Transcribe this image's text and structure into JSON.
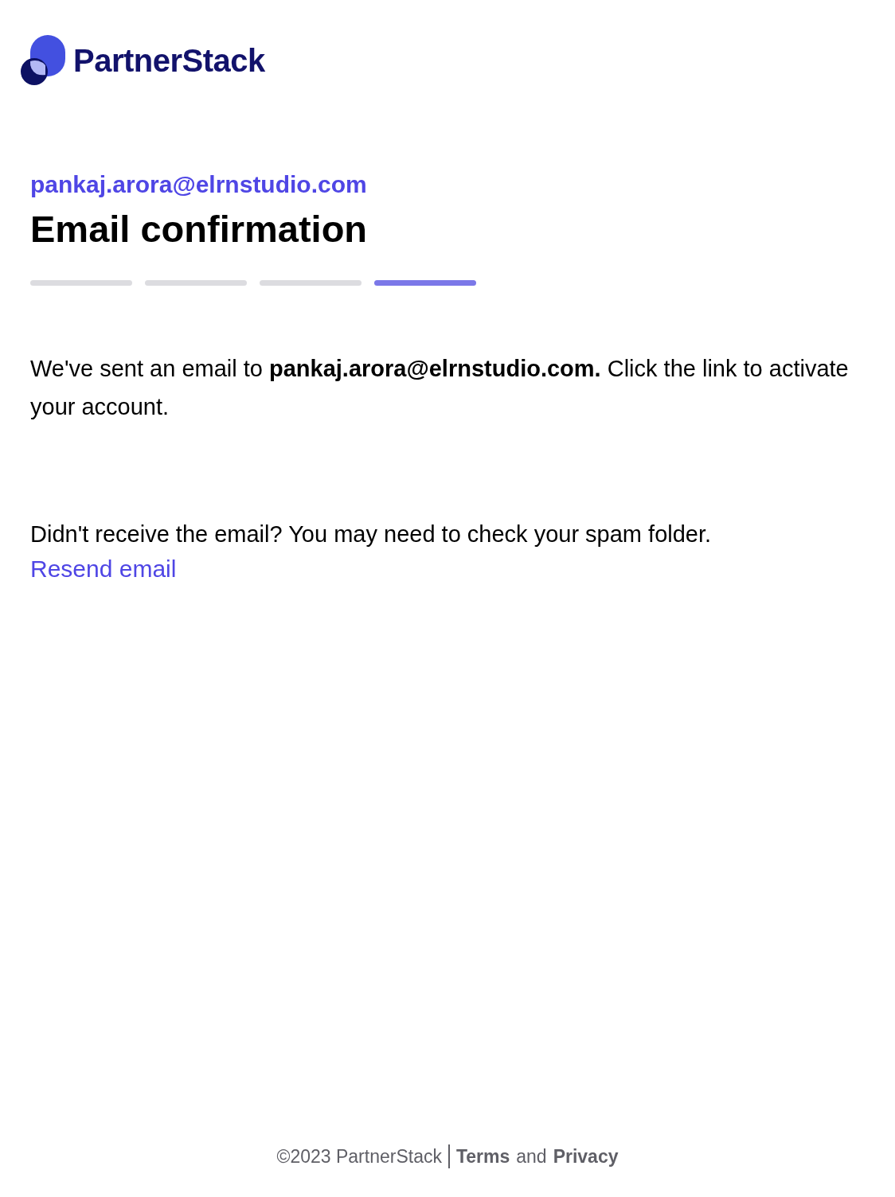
{
  "logo": {
    "wordmark": "PartnerStack"
  },
  "account_email": "pankaj.arora@elrnstudio.com",
  "title": "Email confirmation",
  "progress_steps": [
    {
      "selected": false
    },
    {
      "selected": false
    },
    {
      "selected": false
    },
    {
      "selected": true
    }
  ],
  "message": "We've sent an email to **pankaj.arora@elrnstudio.com.** Click the link to activate your account.",
  "resend_prompt": "Didn't receive the email? You may need to check your spam folder.",
  "resend_link": "Resend email",
  "footer": {
    "copyright": "©2023 PartnerStack",
    "terms_link": "Terms",
    "joiner": "and",
    "privacy_link": "Privacy"
  }
}
